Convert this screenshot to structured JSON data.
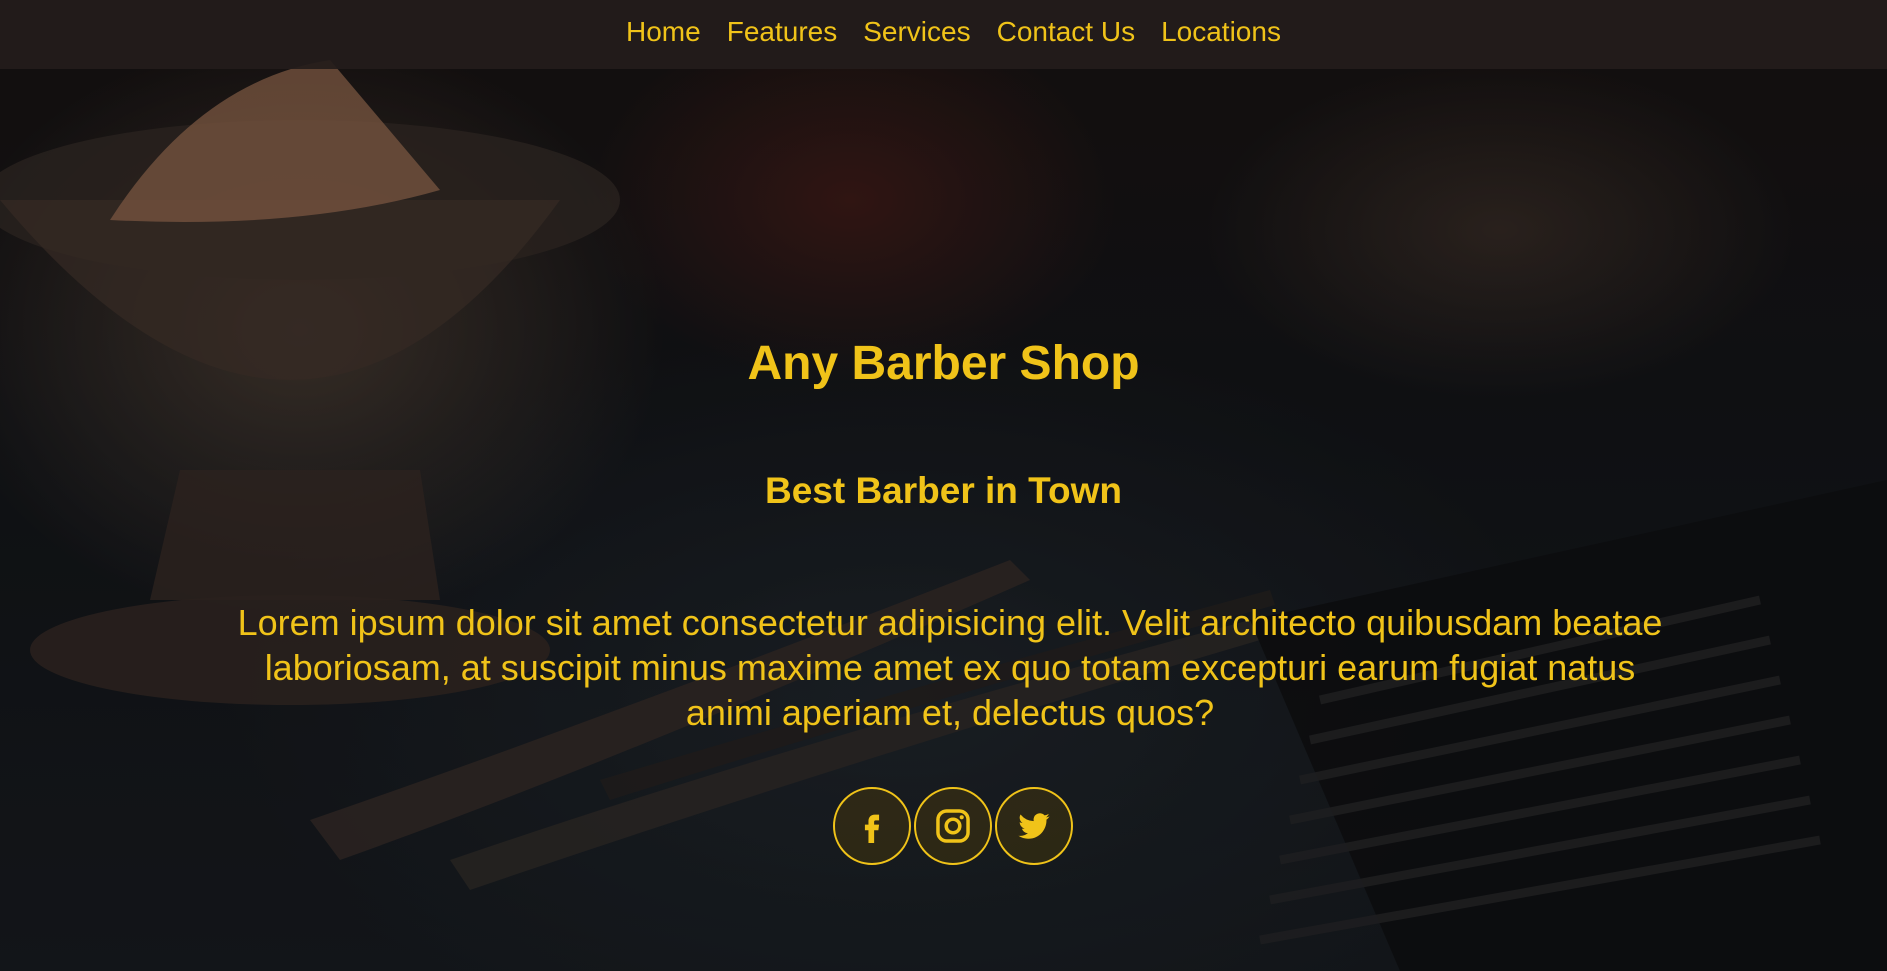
{
  "nav": {
    "links": [
      "Home",
      "Features",
      "Services",
      "Contact Us",
      "Locations"
    ]
  },
  "hero": {
    "title": "Any Barber Shop",
    "subtitle": "Best Barber in Town",
    "description": "Lorem ipsum dolor sit amet consectetur adipisicing elit. Velit architecto quibusdam beatae laboriosam, at suscipit minus maxime amet ex quo totam excepturi earum fugiat natus animi aperiam et, delectus quos?"
  },
  "social": {
    "icons": [
      "facebook-icon",
      "instagram-icon",
      "twitter-icon"
    ]
  },
  "colors": {
    "accent": "#f0c319",
    "nav_background": "#231c1b"
  }
}
